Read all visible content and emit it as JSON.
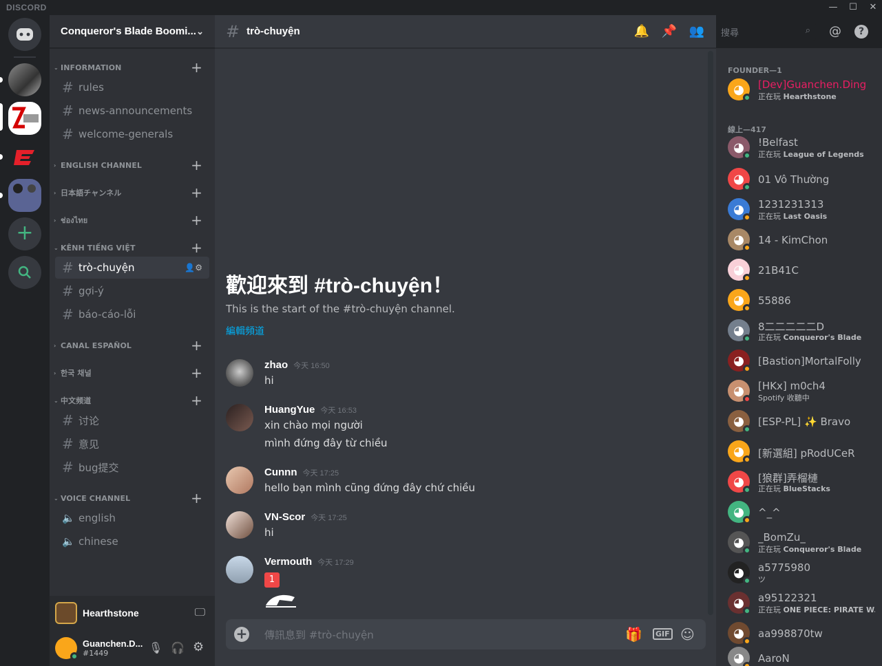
{
  "app": {
    "logo": "DISCORD"
  },
  "window": {
    "minimize": "—",
    "maximize": "☐",
    "close": "✕"
  },
  "guild": {
    "name": "Conqueror's Blade Boomi..."
  },
  "categories": [
    {
      "name": "INFORMATION",
      "channels": [
        "rules",
        "news-announcements",
        "welcome-generals"
      ]
    },
    {
      "name": "ENGLISH CHANNEL",
      "channels": []
    },
    {
      "name": "日本語チャンネル",
      "channels": []
    },
    {
      "name": "ช่องไทย",
      "channels": []
    },
    {
      "name": "KÊNH TIẾNG VIỆT",
      "channels": [
        "trò-chuyện",
        "gợi-ý",
        "báo-cáo-lỗi"
      ]
    },
    {
      "name": "CANAL ESPAÑOL",
      "channels": []
    },
    {
      "name": "한국 채널",
      "channels": []
    },
    {
      "name": "中文频道",
      "channels": [
        "讨论",
        "意见",
        "bug提交"
      ]
    },
    {
      "name": "VOICE CHANNEL",
      "channels": [
        "english",
        "chinese"
      ]
    }
  ],
  "activity": {
    "game": "Hearthstone"
  },
  "user": {
    "name": "Guanchen.D...",
    "tag": "#1449"
  },
  "channel": {
    "name": "trò-chuyện"
  },
  "search": {
    "placeholder": "搜尋"
  },
  "welcome": {
    "title": "歡迎來到 #trò-chuyện！",
    "subtitle": "This is the start of the #trò-chuyện channel.",
    "edit": "編輯頻道"
  },
  "messages": [
    {
      "author": "zhao",
      "time": "今天 16:50",
      "lines": [
        "hi"
      ]
    },
    {
      "author": "HuangYue",
      "time": "今天 16:53",
      "lines": [
        "xin chào mọi người",
        "mình đứng đây từ chiều"
      ]
    },
    {
      "author": "Cunnn",
      "time": "今天 17:25",
      "lines": [
        "hello bạn mình cũng đứng đây chứ chiều"
      ]
    },
    {
      "author": "VN-Scor",
      "time": "今天 17:25",
      "lines": [
        "hi"
      ]
    },
    {
      "author": "Vermouth",
      "time": "今天 17:29",
      "lines": [
        "1"
      ]
    }
  ],
  "composer": {
    "placeholder": "傳訊息到 #trò-chuyện",
    "gif": "GIF"
  },
  "members": {
    "founder_header": "FOUNDER—1",
    "online_header": "線上—417",
    "list": [
      {
        "name": "[Dev]Guanchen.Ding",
        "status": "正在玩 ",
        "game": "Hearthstone",
        "color": "#e91e63"
      },
      {
        "name": "!Belfast",
        "status": "正在玩 ",
        "game": "League of Legends",
        "color": "#b9bbbe"
      },
      {
        "name": "01 Vô Thường",
        "status": "",
        "game": "",
        "color": "#b9bbbe"
      },
      {
        "name": "1231231313",
        "status": "正在玩 ",
        "game": "Last Oasis",
        "color": "#b9bbbe"
      },
      {
        "name": "14 - KimChon",
        "status": "",
        "game": "",
        "color": "#b9bbbe"
      },
      {
        "name": "21B41C",
        "status": "",
        "game": "",
        "color": "#b9bbbe"
      },
      {
        "name": "55886",
        "status": "",
        "game": "",
        "color": "#b9bbbe"
      },
      {
        "name": "8二二二二二D",
        "status": "正在玩 ",
        "game": "Conqueror's Blade",
        "color": "#b9bbbe"
      },
      {
        "name": "[Bastion]MortalFolly",
        "status": "",
        "game": "",
        "color": "#b9bbbe"
      },
      {
        "name": "[HKx] m0ch4",
        "status": "Spotify 收聽中",
        "game": "",
        "color": "#b9bbbe"
      },
      {
        "name": "[ESP-PL] ✨ Bravo",
        "status": "",
        "game": "",
        "color": "#b9bbbe"
      },
      {
        "name": "[新選組] pRodUCeR",
        "status": "",
        "game": "",
        "color": "#b9bbbe"
      },
      {
        "name": "[狼群]弄榴槤",
        "status": "正在玩 ",
        "game": "BlueStacks",
        "color": "#b9bbbe"
      },
      {
        "name": "^_^",
        "status": "",
        "game": "",
        "color": "#b9bbbe"
      },
      {
        "name": "_BomZu_",
        "status": "正在玩 ",
        "game": "Conqueror's Blade",
        "color": "#b9bbbe"
      },
      {
        "name": "a5775980",
        "status": "ツ",
        "game": "",
        "color": "#b9bbbe"
      },
      {
        "name": "a95122321",
        "status": "正在玩 ",
        "game": "ONE PIECE: PIRATE W...",
        "color": "#b9bbbe"
      },
      {
        "name": "aa998870tw",
        "status": "",
        "game": "",
        "color": "#b9bbbe"
      },
      {
        "name": "AaroN",
        "status": "",
        "game": "",
        "color": "#b9bbbe"
      }
    ]
  }
}
